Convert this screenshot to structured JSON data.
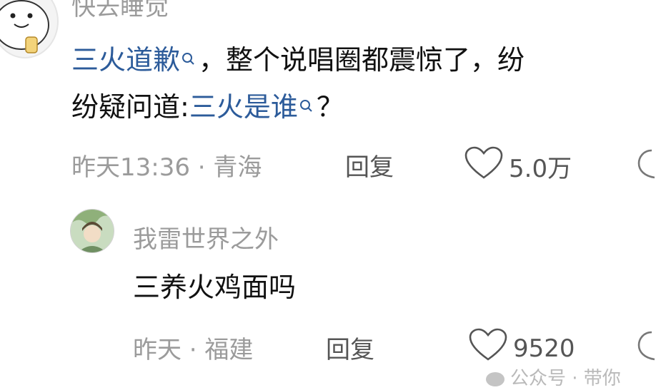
{
  "comments": [
    {
      "username": "快去睡觉",
      "text_segments": [
        {
          "text": "三火道歉",
          "type": "link"
        },
        {
          "text": "，整个说唱圈都震惊了，纷",
          "type": "text"
        }
      ],
      "text_line2_segments": [
        {
          "text": "纷疑问道:",
          "type": "text"
        },
        {
          "text": "三火是谁",
          "type": "link"
        },
        {
          "text": "？",
          "type": "text"
        }
      ],
      "time_location": "昨天13:36 · 青海",
      "reply_label": "回复",
      "likes": "5.0万"
    },
    {
      "username": "我雷世界之外",
      "text": "三养火鸡面吗",
      "time_location": "昨天 · 福建",
      "reply_label": "回复",
      "likes": "9520"
    }
  ],
  "watermark": "公众号 · 带你"
}
